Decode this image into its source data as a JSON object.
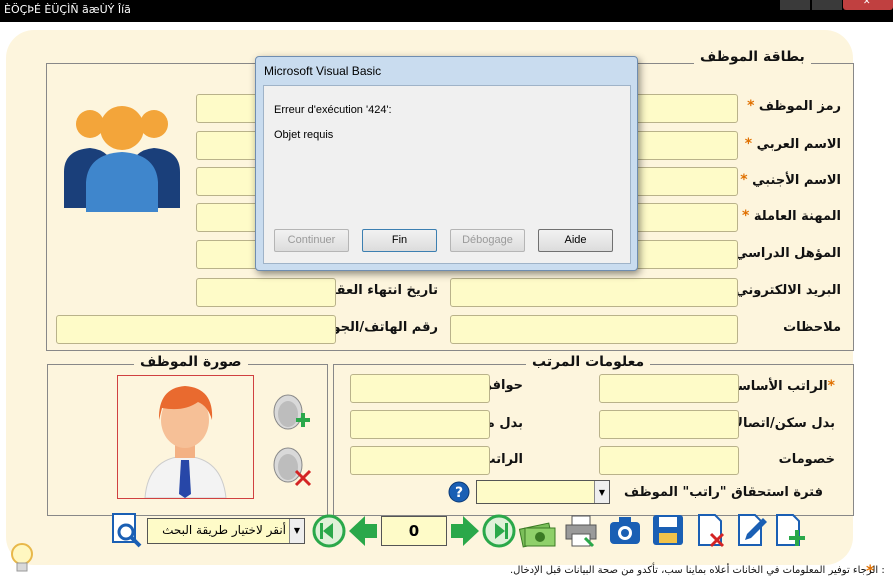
{
  "window": {
    "title": "ÈÖÇÞÉ ÈÜÇÌÑ ãæÙÝ Îíã"
  },
  "card": {
    "title": "بطاقة الموظف"
  },
  "labels": {
    "employee_code": "رمز الموظف",
    "arabic_name": "الاسم العربي",
    "foreign_name": "الاسم الأجنبي",
    "profession": "المهنة العاملة",
    "qualification": "المؤهل الدراسي",
    "email": "البريد الالكتروني",
    "contract_end": "تاريخ انتهاء العقد",
    "notes": "ملاحظات",
    "phone": "رقم الهاتف/الجوال"
  },
  "salary": {
    "title": "معلومات المرتب",
    "basic": "الراتب الأساسي",
    "incentives": "حوافز أضافية",
    "housing": "بدل سكن/اتصالات",
    "transport": "بدل مواصلات",
    "deductions": "خصومات",
    "net": "الراتب الصافي",
    "period_label": "فترة استحقاق \"راتب\" الموظف",
    "period_value": ""
  },
  "photo": {
    "title": "صورة الموظف"
  },
  "search": {
    "placeholder_text": "أنقر لاختيار طريقة البحث",
    "record_number": "0"
  },
  "dialog": {
    "title": "Microsoft Visual Basic",
    "error": "Erreur d'exécution '424':",
    "message": "Objet requis",
    "buttons": {
      "continue": "Continuer",
      "end": "Fin",
      "debug": "Débogage",
      "help": "Aide"
    }
  },
  "footnote": {
    "star": "*",
    "text": ": الرجاء توفير المعلومات في الخانات أعلاه بماينا سب، تأكدو من صحة البيانات قبل الإدخال."
  },
  "colors": {
    "field_bg": "#fefbc8",
    "card_bg": "#fdf5dd",
    "required_star": "#e07000",
    "accent_green": "#2aa84a",
    "accent_blue": "#1a5fb4"
  }
}
